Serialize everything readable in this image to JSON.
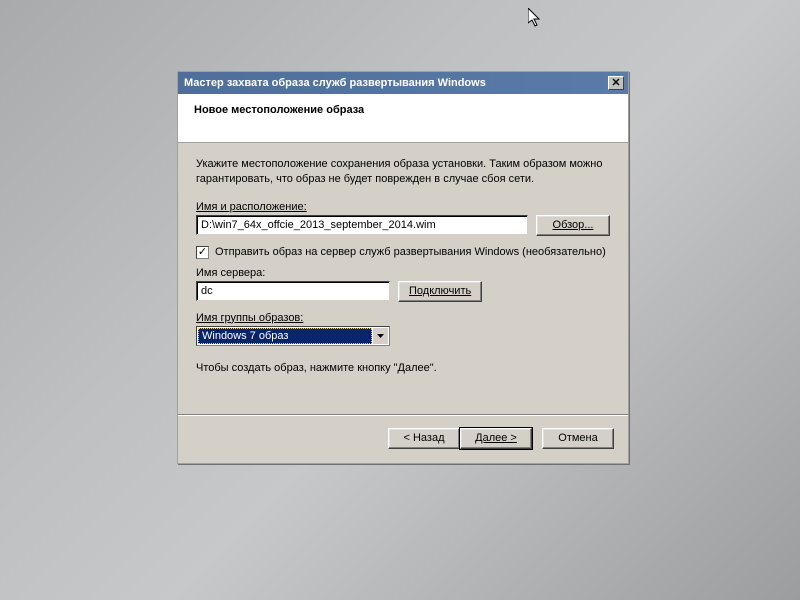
{
  "window": {
    "title": "Мастер захвата образа служб развертывания Windows"
  },
  "header": {
    "title": "Новое местоположение образа"
  },
  "content": {
    "description": "Укажите местоположение сохранения образа установки. Таким образом можно гарантировать, что образ не будет поврежден в случае сбоя сети.",
    "path_label": "Имя и расположение:",
    "path_value": "D:\\win7_64x_offcie_2013_september_2014.wim",
    "browse_button": "Обзор...",
    "upload_checkbox_label": "Отправить образ на сервер служб развертывания Windows (необязательно)",
    "upload_checked": true,
    "server_label": "Имя сервера:",
    "server_value": "dc",
    "connect_button": "Подключить",
    "group_label": "Имя группы образов:",
    "group_value": "Windows 7 образ",
    "instruction": "Чтобы создать образ, нажмите кнопку \"Далее\"."
  },
  "footer": {
    "back": "< Назад",
    "next": "Далее >",
    "cancel": "Отмена"
  },
  "icons": {
    "checkmark": "✓"
  }
}
